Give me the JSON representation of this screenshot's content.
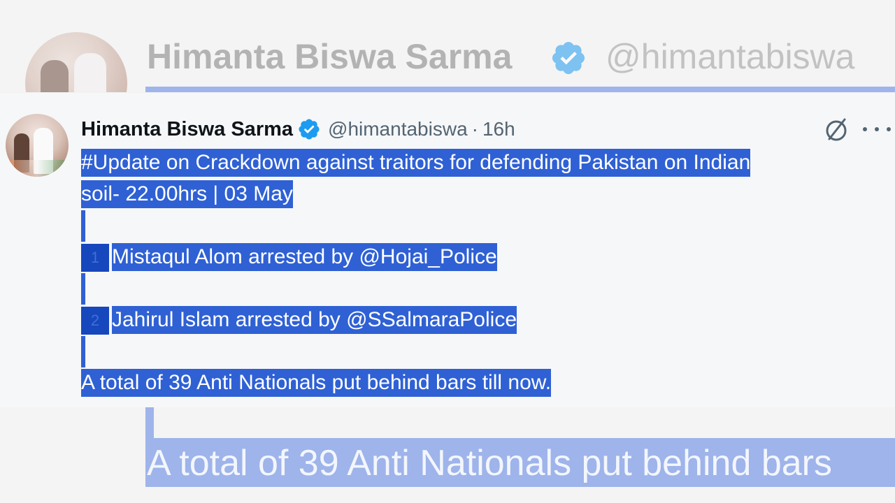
{
  "background": {
    "name": "Himanta Biswa Sarma",
    "handle": "@himantabiswa",
    "bottom_text": "A total of 39 Anti Nationals put behind bars"
  },
  "tweet": {
    "author_name": "Himanta Biswa Sarma",
    "handle": "@himantabiswa",
    "separator": "·",
    "time": "16h",
    "verified_icon": "verified-badge-icon",
    "grok_icon": "grok-icon",
    "more_icon": "more-options-icon",
    "lines": {
      "l1": "#Update on Crackdown against traitors for defending Pakistan on Indian",
      "l2": "soil- 22.00hrs | 03 May",
      "item1_num": "1",
      "item1": "Mistaqul Alom arrested by @Hojai_Police",
      "item2_num": "2",
      "item2": "Jahirul Islam arrested by @SSalmaraPolice",
      "total": "A total of 39 Anti Nationals put behind bars till now."
    }
  },
  "colors": {
    "selection": "#2f61d4",
    "selection_faded": "#9eb4ea",
    "verified": "#1d9bf0",
    "text_secondary": "#536471"
  }
}
